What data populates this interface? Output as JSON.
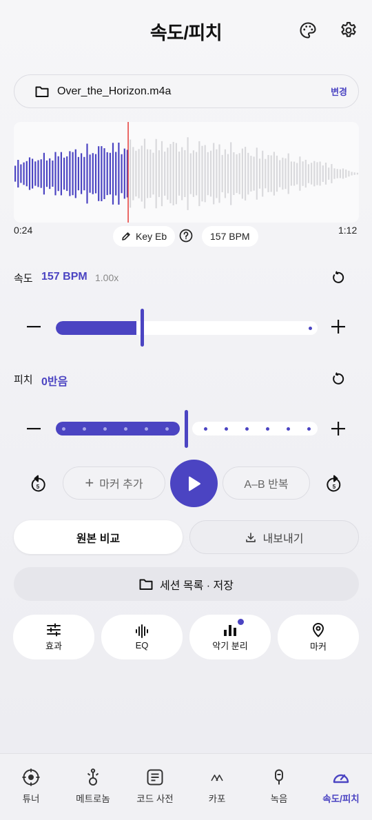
{
  "header": {
    "title": "속도/피치",
    "palette_icon": "palette-icon",
    "settings_icon": "gear-icon"
  },
  "file": {
    "icon": "folder-icon",
    "name": "Over_the_Horizon.m4a",
    "change_label": "변경"
  },
  "waveform": {
    "current_time": "0:24",
    "total_time": "1:12",
    "progress": 0.33,
    "key_label": "Key Eb",
    "bpm_label": "157 BPM",
    "played_color": "#4b44c2",
    "unplayed_color": "#d9d9dc",
    "playhead_color": "#e53935"
  },
  "speed": {
    "label": "속도",
    "value": "157 BPM",
    "multiplier": "1.00x",
    "level": 0.33
  },
  "pitch": {
    "label": "피치",
    "value": "0반음",
    "level": 0.5
  },
  "transport": {
    "marker_add": "마커 추가",
    "ab_repeat": "A–B 반복",
    "rewind_seconds": "5",
    "forward_seconds": "5"
  },
  "actions": {
    "compare": "원본 비교",
    "export": "내보내기",
    "sessions": "세션 목록 · 저장"
  },
  "tools": [
    {
      "label": "효과",
      "icon": "sliders-icon"
    },
    {
      "label": "EQ",
      "icon": "eq-icon"
    },
    {
      "label": "악기 분리",
      "icon": "bars-icon"
    },
    {
      "label": "마커",
      "icon": "pin-icon"
    }
  ],
  "nav": [
    {
      "label": "튜너",
      "icon": "tuner-icon"
    },
    {
      "label": "메트로놈",
      "icon": "metronome-icon"
    },
    {
      "label": "코드 사전",
      "icon": "chord-book-icon"
    },
    {
      "label": "카포",
      "icon": "capo-icon"
    },
    {
      "label": "녹음",
      "icon": "mic-icon"
    },
    {
      "label": "속도/피치",
      "icon": "speedometer-icon",
      "active": true
    }
  ],
  "colors": {
    "accent": "#4b44c2",
    "background": "#efeff3"
  }
}
